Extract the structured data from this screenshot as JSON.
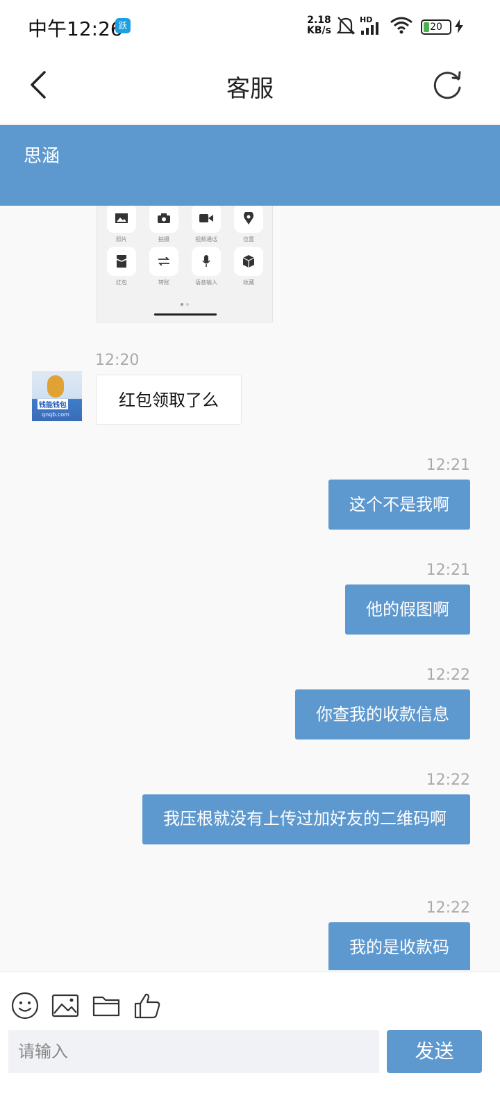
{
  "status_bar": {
    "time": "中午12:26",
    "app_badge": "跃",
    "net_speed_value": "2.18",
    "net_speed_unit": "KB/s",
    "network_label": "HD",
    "battery": "20"
  },
  "header": {
    "title": "客服",
    "back_icon": "chevron-left-icon",
    "refresh_icon": "refresh-icon"
  },
  "agent": {
    "name": "思涵"
  },
  "screenshot_grid": {
    "items": [
      {
        "label": "照片",
        "icon": "image-icon"
      },
      {
        "label": "拍摄",
        "icon": "camera-icon"
      },
      {
        "label": "视频通话",
        "icon": "video-icon"
      },
      {
        "label": "位置",
        "icon": "location-icon"
      },
      {
        "label": "红包",
        "icon": "red-packet-icon"
      },
      {
        "label": "转账",
        "icon": "transfer-icon"
      },
      {
        "label": "语音输入",
        "icon": "mic-icon"
      },
      {
        "label": "收藏",
        "icon": "cube-icon"
      }
    ]
  },
  "avatar": {
    "logo_text": "钱能钱包",
    "url_text": "qnqb.com"
  },
  "messages": [
    {
      "side": "left",
      "time": "12:20",
      "text": "红包领取了么"
    },
    {
      "side": "right",
      "time": "12:21",
      "text": "这个不是我啊"
    },
    {
      "side": "right",
      "time": "12:21",
      "text": "他的假图啊"
    },
    {
      "side": "right",
      "time": "12:22",
      "text": "你查我的收款信息"
    },
    {
      "side": "right",
      "time": "12:22",
      "text": "我压根就没有上传过加好友的二维码啊"
    },
    {
      "side": "right",
      "time": "12:22",
      "text": "我的是收款码"
    }
  ],
  "toolbar": {
    "icons": [
      "emoji-icon",
      "image-icon",
      "folder-icon",
      "thumbs-up-icon"
    ]
  },
  "composer": {
    "placeholder": "请输入",
    "send_label": "发送"
  },
  "colors": {
    "accent": "#5d98cf",
    "background": "#f9f9f9"
  }
}
